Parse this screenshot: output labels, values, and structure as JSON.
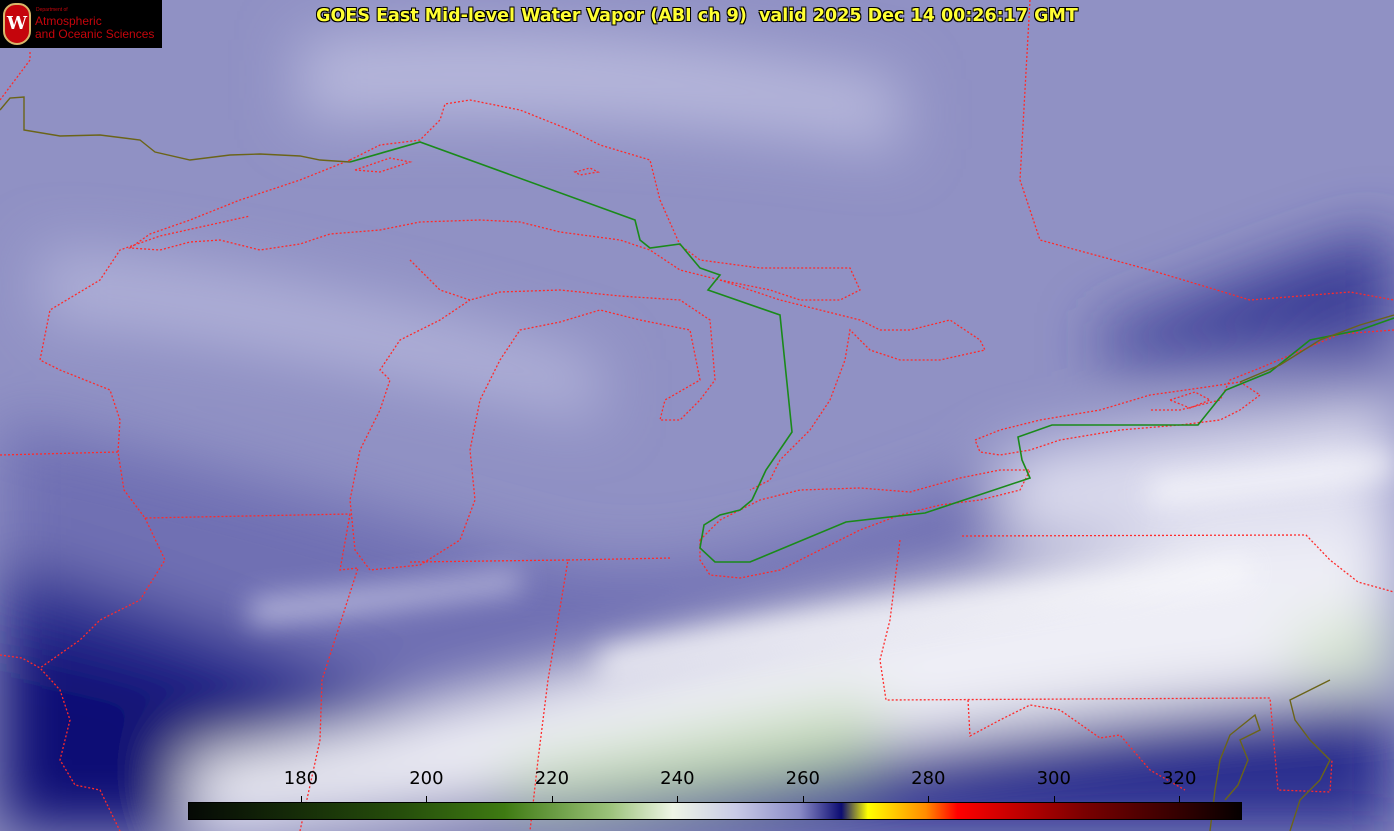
{
  "title": "GOES East Mid-level Water Vapor (ABI ch 9)  valid 2025 Dec 14 00:26:17 GMT",
  "logo": {
    "line1": "Department of",
    "line2": "Atmospheric",
    "line3": "and Oceanic Sciences",
    "seal_letter": "W"
  },
  "colorbar": {
    "ticks": [
      "180",
      "200",
      "220",
      "240",
      "260",
      "280",
      "300",
      "320"
    ],
    "range": [
      162,
      330
    ],
    "colors": {
      "dark": "#050905",
      "green": "#3e7a12",
      "light_green": "#d6e8c4",
      "white": "#f8f8fb",
      "lavender": "#9b9cd0",
      "navy": "#0c0c72",
      "yellow": "#ffff00",
      "orange": "#ff8c00",
      "red": "#ff0000",
      "dark_red": "#7a0000",
      "black": "#050000"
    }
  },
  "map_colors": {
    "background": "#8e8fc0",
    "dry_band": "#1b1f84",
    "moist_band": "#eeeef6",
    "cold_cloud": "#cfe3c2",
    "state_borders": "#ff2a2a",
    "intl_border": "#1a8a1a",
    "coast": "#6b6418"
  }
}
